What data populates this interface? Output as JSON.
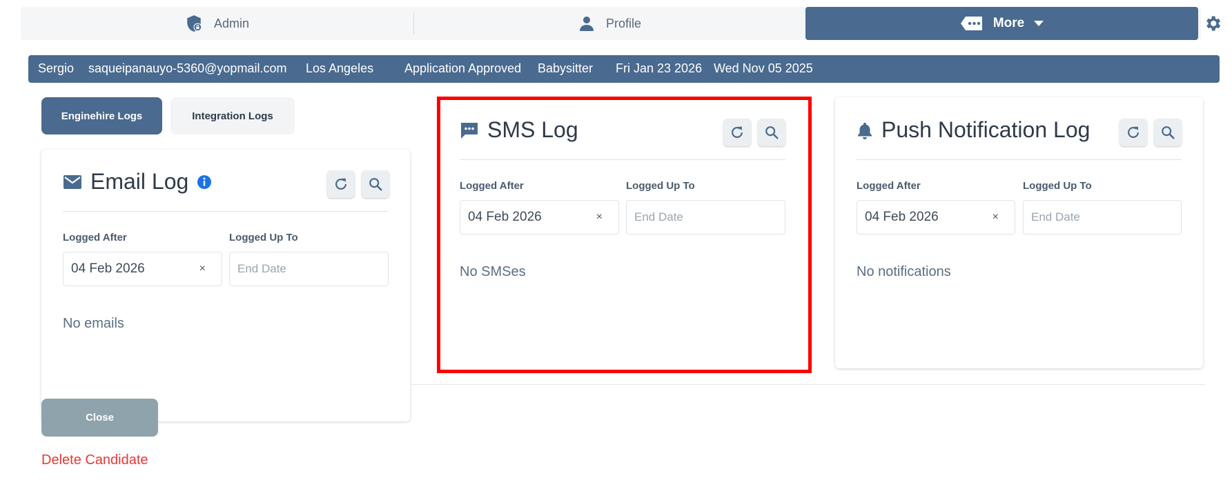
{
  "nav": {
    "admin_label": "Admin",
    "profile_label": "Profile",
    "more_label": "More"
  },
  "candidate": {
    "name": "Sergio",
    "email": "saqueipanauyo-5360@yopmail.com",
    "city": "Los Angeles",
    "status": "Application Approved",
    "role": "Babysitter",
    "date1": "Fri Jan 23 2026",
    "date2": "Wed Nov 05 2025"
  },
  "tabs": {
    "enginehire": "Enginehire Logs",
    "integration": "Integration Logs"
  },
  "email_log": {
    "title": "Email Log",
    "logged_after_label": "Logged After",
    "logged_up_to_label": "Logged Up To",
    "after_value": "04 Feb 2026",
    "clear": "×",
    "end_placeholder": "End Date",
    "empty": "No emails"
  },
  "sms_log": {
    "title": "SMS Log",
    "logged_after_label": "Logged After",
    "logged_up_to_label": "Logged Up To",
    "after_value": "04 Feb 2026",
    "clear": "×",
    "end_placeholder": "End Date",
    "empty": "No SMSes"
  },
  "push_log": {
    "title": "Push Notification Log",
    "logged_after_label": "Logged After",
    "logged_up_to_label": "Logged Up To",
    "after_value": "04 Feb 2026",
    "clear": "×",
    "end_placeholder": "End Date",
    "empty": "No notifications"
  },
  "actions": {
    "close": "Close",
    "delete": "Delete Candidate"
  },
  "colors": {
    "primary": "#4a6a8f",
    "highlight": "#ff0000",
    "danger": "#e53935",
    "info": "#1a73e8"
  },
  "icons": {
    "admin": "shield-lock-icon",
    "profile": "person-icon",
    "more": "ellipsis-tag-icon",
    "settings": "gear-icon",
    "email": "envelope-icon",
    "sms": "chat-bubble-icon",
    "push": "bell-icon",
    "refresh": "refresh-icon",
    "search": "search-icon",
    "info": "info-icon"
  }
}
